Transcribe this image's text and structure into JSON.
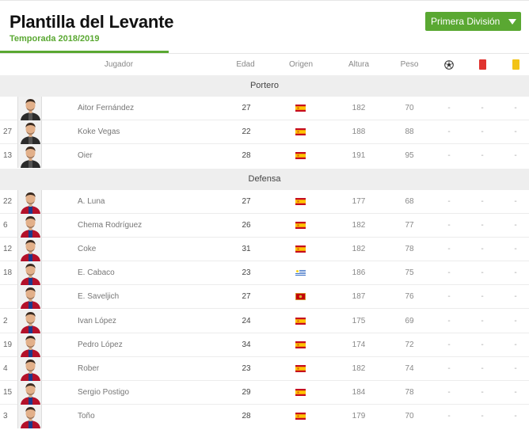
{
  "header": {
    "title": "Plantilla del Levante",
    "subtitle": "Temporada 2018/2019",
    "league_select": "Primera División"
  },
  "columns": {
    "jugador": "Jugador",
    "edad": "Edad",
    "origen": "Origen",
    "altura": "Altura",
    "peso": "Peso",
    "goals_icon": "soccer-ball-icon",
    "red_card_icon": "red-card-icon",
    "yellow_card_icon": "yellow-card-icon"
  },
  "colors": {
    "accent": "#5aa832",
    "red_card": "#e0332f",
    "yellow_card": "#f2c316"
  },
  "sections": [
    {
      "title": "Portero",
      "players": [
        {
          "number": "",
          "name": "Aitor Fernández",
          "age": "27",
          "flag": "spain-flag",
          "height": "182",
          "weight": "70",
          "goals": "-",
          "red": "-",
          "yellow": "-"
        },
        {
          "number": "27",
          "name": "Koke Vegas",
          "age": "22",
          "flag": "spain-flag",
          "height": "188",
          "weight": "88",
          "goals": "-",
          "red": "-",
          "yellow": "-"
        },
        {
          "number": "13",
          "name": "Oier",
          "age": "28",
          "flag": "spain-flag",
          "height": "191",
          "weight": "95",
          "goals": "-",
          "red": "-",
          "yellow": "-"
        }
      ]
    },
    {
      "title": "Defensa",
      "players": [
        {
          "number": "22",
          "name": "A. Luna",
          "age": "27",
          "flag": "spain-flag",
          "height": "177",
          "weight": "68",
          "goals": "-",
          "red": "-",
          "yellow": "-"
        },
        {
          "number": "6",
          "name": "Chema Rodríguez",
          "age": "26",
          "flag": "spain-flag",
          "height": "182",
          "weight": "77",
          "goals": "-",
          "red": "-",
          "yellow": "-"
        },
        {
          "number": "12",
          "name": "Coke",
          "age": "31",
          "flag": "spain-flag",
          "height": "182",
          "weight": "78",
          "goals": "-",
          "red": "-",
          "yellow": "-"
        },
        {
          "number": "18",
          "name": "E. Cabaco",
          "age": "23",
          "flag": "uruguay-flag",
          "height": "186",
          "weight": "75",
          "goals": "-",
          "red": "-",
          "yellow": "-"
        },
        {
          "number": "",
          "name": "E. Saveljich",
          "age": "27",
          "flag": "montenegro-flag",
          "height": "187",
          "weight": "76",
          "goals": "-",
          "red": "-",
          "yellow": "-"
        },
        {
          "number": "2",
          "name": "Ivan López",
          "age": "24",
          "flag": "spain-flag",
          "height": "175",
          "weight": "69",
          "goals": "-",
          "red": "-",
          "yellow": "-"
        },
        {
          "number": "19",
          "name": "Pedro López",
          "age": "34",
          "flag": "spain-flag",
          "height": "174",
          "weight": "72",
          "goals": "-",
          "red": "-",
          "yellow": "-"
        },
        {
          "number": "4",
          "name": "Rober",
          "age": "23",
          "flag": "spain-flag",
          "height": "182",
          "weight": "74",
          "goals": "-",
          "red": "-",
          "yellow": "-"
        },
        {
          "number": "15",
          "name": "Sergio Postigo",
          "age": "29",
          "flag": "spain-flag",
          "height": "184",
          "weight": "78",
          "goals": "-",
          "red": "-",
          "yellow": "-"
        },
        {
          "number": "3",
          "name": "Toño",
          "age": "28",
          "flag": "spain-flag",
          "height": "179",
          "weight": "70",
          "goals": "-",
          "red": "-",
          "yellow": "-"
        }
      ]
    }
  ]
}
